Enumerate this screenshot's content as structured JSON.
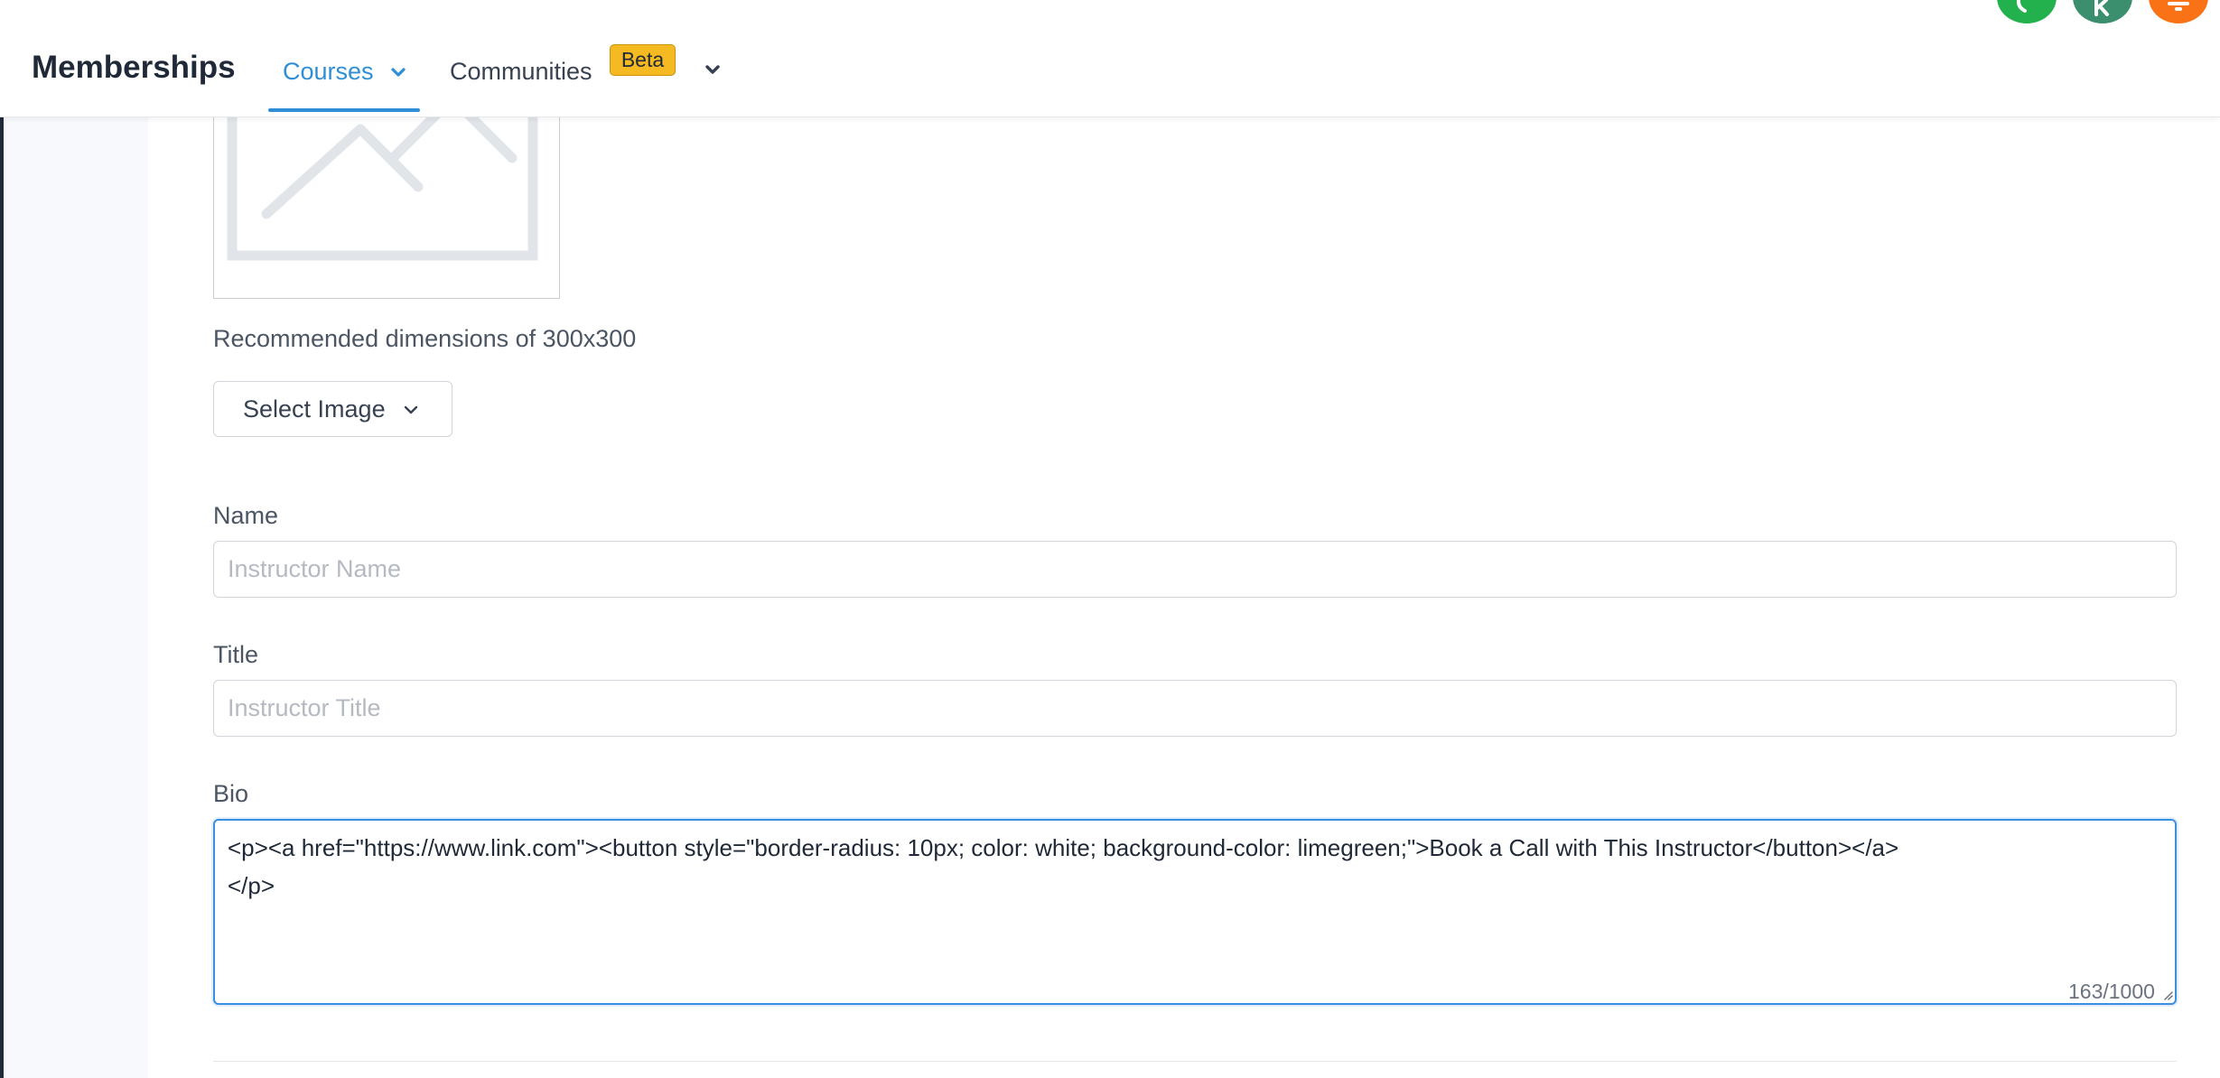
{
  "header": {
    "brand": "Memberships",
    "tabs": [
      {
        "label": "Courses",
        "active": true
      },
      {
        "label": "Communities",
        "badge": "Beta"
      }
    ],
    "accent_color": "#2f8fd6",
    "badge_color": "#f5b922"
  },
  "top_icons": [
    "phone-icon",
    "k-icon",
    "bell-icon"
  ],
  "image_section": {
    "dimensions_note": "Recommended dimensions of 300x300",
    "select_button_label": "Select Image"
  },
  "form": {
    "name": {
      "label": "Name",
      "placeholder": "Instructor Name",
      "value": ""
    },
    "title": {
      "label": "Title",
      "placeholder": "Instructor Title",
      "value": ""
    },
    "bio": {
      "label": "Bio",
      "value": "<p><a href=\"https://www.link.com\"><button style=\"border-radius: 10px; color: white; background-color: limegreen;\">Book a Call with This Instructor</button></a>\n</p>",
      "char_count": "163/1000"
    }
  }
}
